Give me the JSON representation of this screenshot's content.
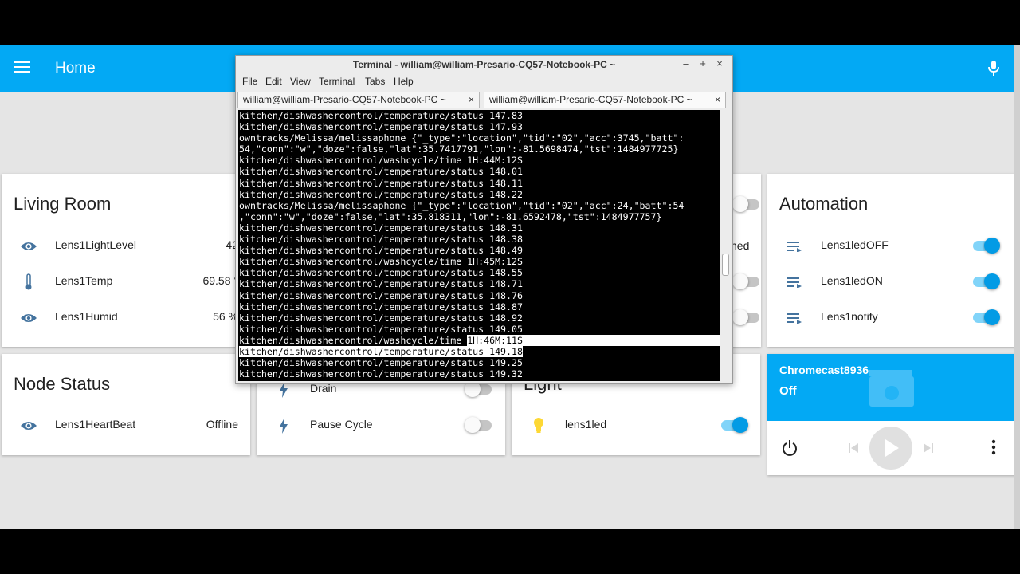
{
  "app": {
    "title": "Home"
  },
  "icons": {
    "menu": "menu-icon",
    "mic": "microphone-icon",
    "eye": "eye-icon",
    "thermometer": "thermometer-icon",
    "flash": "flash-icon",
    "bulb": "lightbulb-icon",
    "script": "script-list-icon",
    "film": "movie-icon",
    "power": "power-icon",
    "prev": "skip-previous-icon",
    "play": "play-icon",
    "next": "skip-next-icon",
    "more": "more-vert-icon"
  },
  "colors": {
    "accent": "#03a9f4",
    "toggle_on": "#039be5",
    "bulb": "#fdd835",
    "icon": "#44739e"
  },
  "living_room": {
    "title": "Living Room",
    "rows": [
      {
        "label": "Lens1LightLevel",
        "value": "42"
      },
      {
        "label": "Lens1Temp",
        "value": "69.58 °"
      },
      {
        "label": "Lens1Humid",
        "value": "56 %"
      }
    ]
  },
  "node_status": {
    "title": "Node Status",
    "rows": [
      {
        "label": "Lens1HeartBeat",
        "value": "Offline"
      }
    ]
  },
  "dishwasher": {
    "rows": [
      {
        "label": "Drain",
        "on": false
      },
      {
        "label": "Pause Cycle",
        "on": false
      }
    ]
  },
  "middle_card": {
    "partial_text": "ned"
  },
  "light": {
    "title": "Light",
    "rows": [
      {
        "label": "lens1led",
        "on": true
      }
    ]
  },
  "automation": {
    "title": "Automation",
    "rows": [
      {
        "label": "Lens1ledOFF",
        "on": true
      },
      {
        "label": "Lens1ledON",
        "on": true
      },
      {
        "label": "Lens1notify",
        "on": true
      }
    ]
  },
  "chromecast": {
    "name": "Chromecast8936",
    "state": "Off"
  },
  "terminal": {
    "title": "Terminal - william@william-Presario-CQ57-Notebook-PC ~",
    "window_buttons": [
      "–",
      "+",
      "×"
    ],
    "menu": [
      "File",
      "Edit",
      "View",
      "Terminal",
      "Tabs",
      "Help"
    ],
    "tabs": [
      {
        "label": "william@william-Presario-CQ57-Notebook-PC ~",
        "close": "×"
      },
      {
        "label": "william@william-Presario-CQ57-Notebook-PC ~",
        "close": "×"
      }
    ],
    "lines": [
      "kitchen/dishwashercontrol/temperature/status 147.83",
      "kitchen/dishwashercontrol/temperature/status 147.93",
      "owntracks/Melissa/melissaphone {\"_type\":\"location\",\"tid\":\"02\",\"acc\":3745,\"batt\":",
      "54,\"conn\":\"w\",\"doze\":false,\"lat\":35.7417791,\"lon\":-81.5698474,\"tst\":1484977725}",
      "kitchen/dishwashercontrol/washcycle/time 1H:44M:12S",
      "kitchen/dishwashercontrol/temperature/status 148.01",
      "kitchen/dishwashercontrol/temperature/status 148.11",
      "kitchen/dishwashercontrol/temperature/status 148.22",
      "owntracks/Melissa/melissaphone {\"_type\":\"location\",\"tid\":\"02\",\"acc\":24,\"batt\":54",
      ",\"conn\":\"w\",\"doze\":false,\"lat\":35.818311,\"lon\":-81.6592478,\"tst\":1484977757}",
      "kitchen/dishwashercontrol/temperature/status 148.31",
      "kitchen/dishwashercontrol/temperature/status 148.38",
      "kitchen/dishwashercontrol/temperature/status 148.49",
      "kitchen/dishwashercontrol/washcycle/time 1H:45M:12S",
      "kitchen/dishwashercontrol/temperature/status 148.55",
      "kitchen/dishwashercontrol/temperature/status 148.71",
      "kitchen/dishwashercontrol/temperature/status 148.76",
      "kitchen/dishwashercontrol/temperature/status 148.87",
      "kitchen/dishwashercontrol/temperature/status 148.92",
      "kitchen/dishwashercontrol/temperature/status 149.05"
    ],
    "hl_prefix": "kitchen/dishwashercontrol/washcycle/time ",
    "hl_value": "1H:46M:11S",
    "hl_line2": "kitchen/dishwashercontrol/temperature/status 149.18",
    "tail_lines": [
      "kitchen/dishwashercontrol/temperature/status 149.25",
      "kitchen/dishwashercontrol/temperature/status 149.32"
    ]
  }
}
